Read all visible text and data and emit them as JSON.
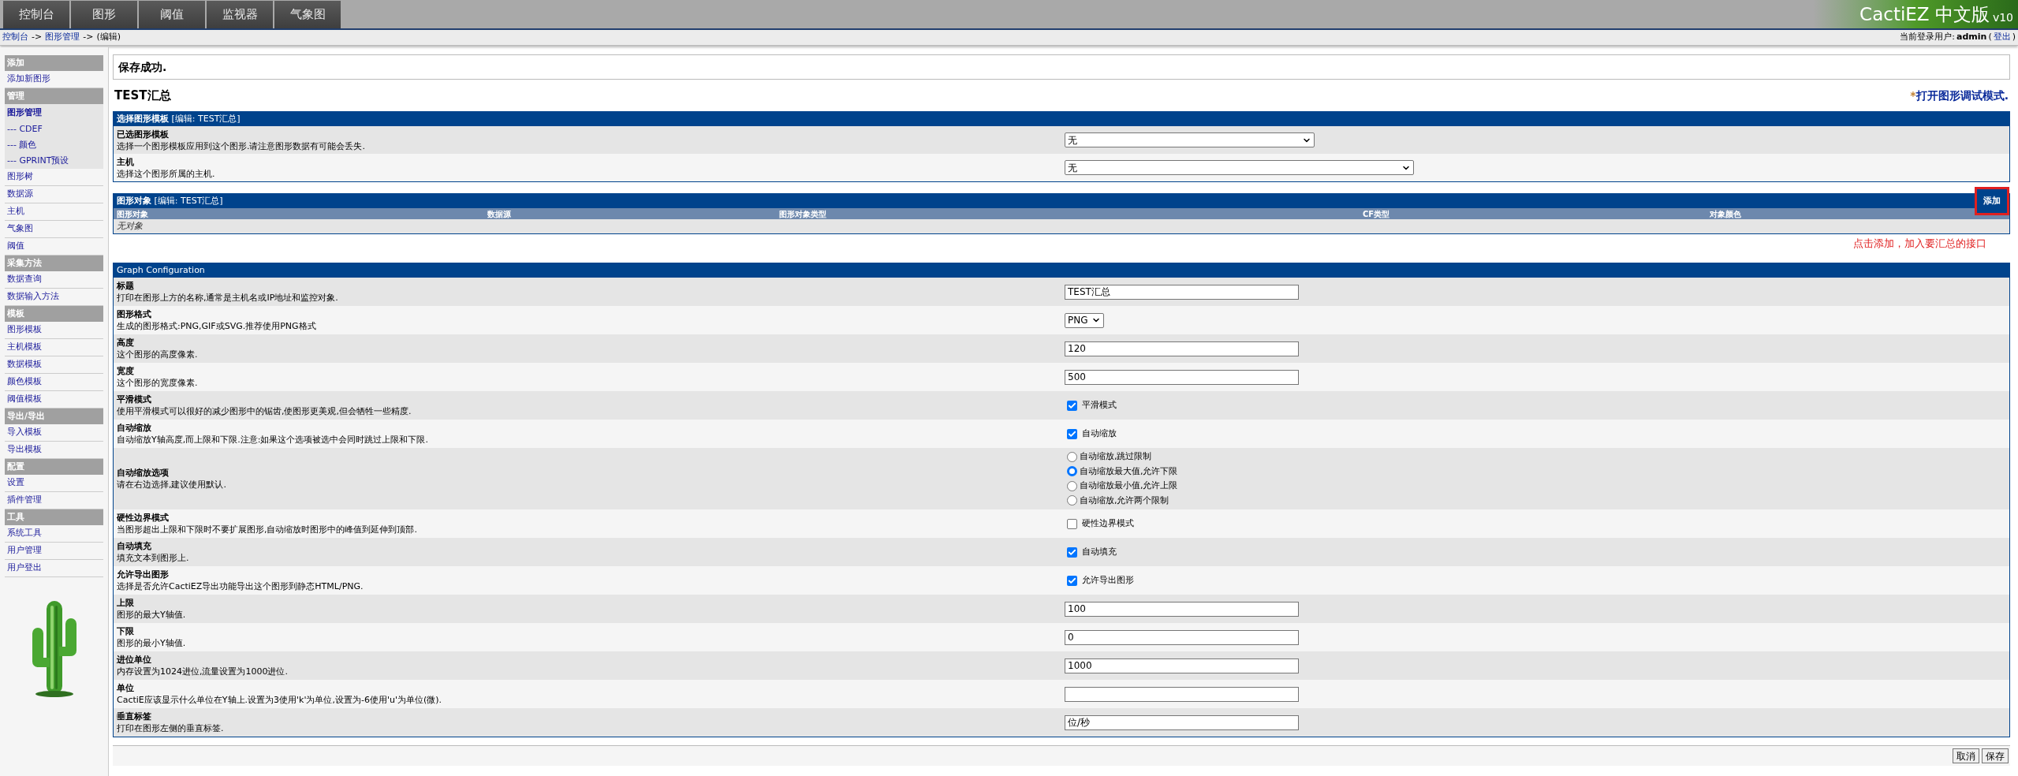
{
  "top_tabs": [
    {
      "label": "控制台",
      "selected": false
    },
    {
      "label": "图形",
      "selected": false
    },
    {
      "label": "阈值",
      "selected": false
    },
    {
      "label": "监视器",
      "selected": false
    },
    {
      "label": "气象图",
      "selected": false
    }
  ],
  "logo": {
    "name": "CactiEZ 中文版",
    "version": "v10"
  },
  "breadcrumb": [
    {
      "text": "控制台",
      "kind": "link"
    },
    {
      "text": "->",
      "kind": "text"
    },
    {
      "text": "图形管理",
      "kind": "link"
    },
    {
      "text": "->",
      "kind": "text"
    },
    {
      "text": "(编辑)",
      "kind": "text"
    }
  ],
  "user_line": [
    {
      "text": "当前登录用户:",
      "kind": "text"
    },
    {
      "text": "admin",
      "kind": "user"
    },
    {
      "text": "(",
      "kind": "text"
    },
    {
      "text": "登出",
      "kind": "link"
    },
    {
      "text": ")",
      "kind": "text"
    }
  ],
  "sidebar": [
    {
      "heading": "添加",
      "items": [
        {
          "label": "添加新图形",
          "selected": false
        }
      ]
    },
    {
      "heading": "管理",
      "items": [
        {
          "label": "图形管理",
          "selected": true,
          "children": [
            {
              "label": "--- CDEF",
              "selected": false
            },
            {
              "label": "--- 颜色",
              "selected": false
            },
            {
              "label": "--- GPRINT预设",
              "selected": false
            }
          ]
        },
        {
          "label": "图形树",
          "selected": false
        },
        {
          "label": "数据源",
          "selected": false
        },
        {
          "label": "主机",
          "selected": false
        },
        {
          "label": "气象图",
          "selected": false
        },
        {
          "label": "阈值",
          "selected": false
        }
      ]
    },
    {
      "heading": "采集方法",
      "items": [
        {
          "label": "数据查询",
          "selected": false
        },
        {
          "label": "数据输入方法",
          "selected": false
        }
      ]
    },
    {
      "heading": "模板",
      "items": [
        {
          "label": "图形模板",
          "selected": false
        },
        {
          "label": "主机模板",
          "selected": false
        },
        {
          "label": "数据模板",
          "selected": false
        },
        {
          "label": "颜色模板",
          "selected": false
        },
        {
          "label": "阈值模板",
          "selected": false
        }
      ]
    },
    {
      "heading": "导出/导出",
      "items": [
        {
          "label": "导入模板",
          "selected": false
        },
        {
          "label": "导出模板",
          "selected": false
        }
      ]
    },
    {
      "heading": "配置",
      "items": [
        {
          "label": "设置",
          "selected": false
        },
        {
          "label": "插件管理",
          "selected": false
        }
      ]
    },
    {
      "heading": "工具",
      "items": [
        {
          "label": "系统工具",
          "selected": false
        },
        {
          "label": "用户管理",
          "selected": false
        },
        {
          "label": "用户登出",
          "selected": false
        }
      ]
    }
  ],
  "message": "保存成功.",
  "page_title": "TEST汇总",
  "debug_link": {
    "mark": "*",
    "text": "打开图形调试模式."
  },
  "template_section": {
    "title": "**选择图形模板** [编辑: TEST汇总]",
    "rows": [
      {
        "label": "已选图形模板",
        "description": "选择一个图形模板应用到这个图形.请注意图形数据有可能会丢失.",
        "value": "无",
        "kind": "short"
      },
      {
        "label": "主机",
        "description": "选择这个图形所属的主机.",
        "value": "无",
        "kind": "long"
      }
    ]
  },
  "items_section": {
    "title": "**图形对象** [编辑: TEST汇总]",
    "add_button": "添加",
    "highlighted": true,
    "columns": [
      "图形对象",
      "数据源",
      "图形对象类型",
      "CF类型",
      "对象颜色"
    ],
    "empty": "无对象",
    "note": "点击添加，加入要汇总的接口"
  },
  "config": {
    "title": "Graph Configuration",
    "rows": [
      {
        "label": "标题",
        "description": "打印在图形上方的名称,通常是主机名或IP地址和监控对象.",
        "kind": "text",
        "value": "TEST汇总"
      },
      {
        "label": "图形格式",
        "description": "生成的图形格式:PNG,GIF或SVG.推荐使用PNG格式",
        "kind": "select",
        "value": "PNG"
      },
      {
        "label": "高度",
        "description": "这个图形的高度像素.",
        "kind": "text",
        "value": "120"
      },
      {
        "label": "宽度",
        "description": "这个图形的宽度像素.",
        "kind": "text",
        "value": "500"
      },
      {
        "label": "平滑模式",
        "description": "使用平滑模式可以很好的减少图形中的锯齿,使图形更美观,但会牺牲一些精度.",
        "kind": "checkbox",
        "checked": true,
        "option": "平滑模式"
      },
      {
        "label": "自动缩放",
        "description": "自动缩放Y轴高度,而上限和下限.注意:如果这个选项被选中会同时跳过上限和下限.",
        "kind": "checkbox",
        "checked": true,
        "option": "自动缩放"
      },
      {
        "label": "自动缩放选项",
        "description": "请在右边选择,建议使用默认.",
        "kind": "radio",
        "options": [
          {
            "label": "自动缩放,跳过限制",
            "selected": false
          },
          {
            "label": "自动缩放最大值,允许下限",
            "selected": true
          },
          {
            "label": "自动缩放最小值,允许上限",
            "selected": false
          },
          {
            "label": "自动缩放,允许两个限制",
            "selected": false
          }
        ]
      },
      {
        "label": "硬性边界模式",
        "description": "当图形超出上限和下限时不要扩展图形,自动缩放时图形中的峰值到延伸到顶部.",
        "kind": "checkbox",
        "checked": false,
        "option": "硬性边界模式"
      },
      {
        "label": "自动填充",
        "description": "填充文本到图形上.",
        "kind": "checkbox",
        "checked": true,
        "option": "自动填充"
      },
      {
        "label": "允许导出图形",
        "description": "选择是否允许CactiEZ导出功能导出这个图形到静态HTML/PNG.",
        "kind": "checkbox",
        "checked": true,
        "option": "允许导出图形"
      },
      {
        "label": "上限",
        "description": "图形的最大Y轴值.",
        "kind": "text",
        "value": "100"
      },
      {
        "label": "下限",
        "description": "图形的最小Y轴值.",
        "kind": "text",
        "value": "0"
      },
      {
        "label": "进位单位",
        "description": "内存设置为1024进位,流量设置为1000进位.",
        "kind": "text",
        "value": "1000"
      },
      {
        "label": "单位",
        "description": "CactiE应该显示什么单位在Y轴上.设置为3使用'k'为单位,设置为-6使用'u'为单位(微).",
        "kind": "text"
      },
      {
        "label": "垂直标签",
        "description": "打印在图形左侧的垂直标签.",
        "kind": "text",
        "value": "位/秒"
      }
    ]
  },
  "footer": {
    "buttons": [
      "取消",
      "保存"
    ]
  }
}
